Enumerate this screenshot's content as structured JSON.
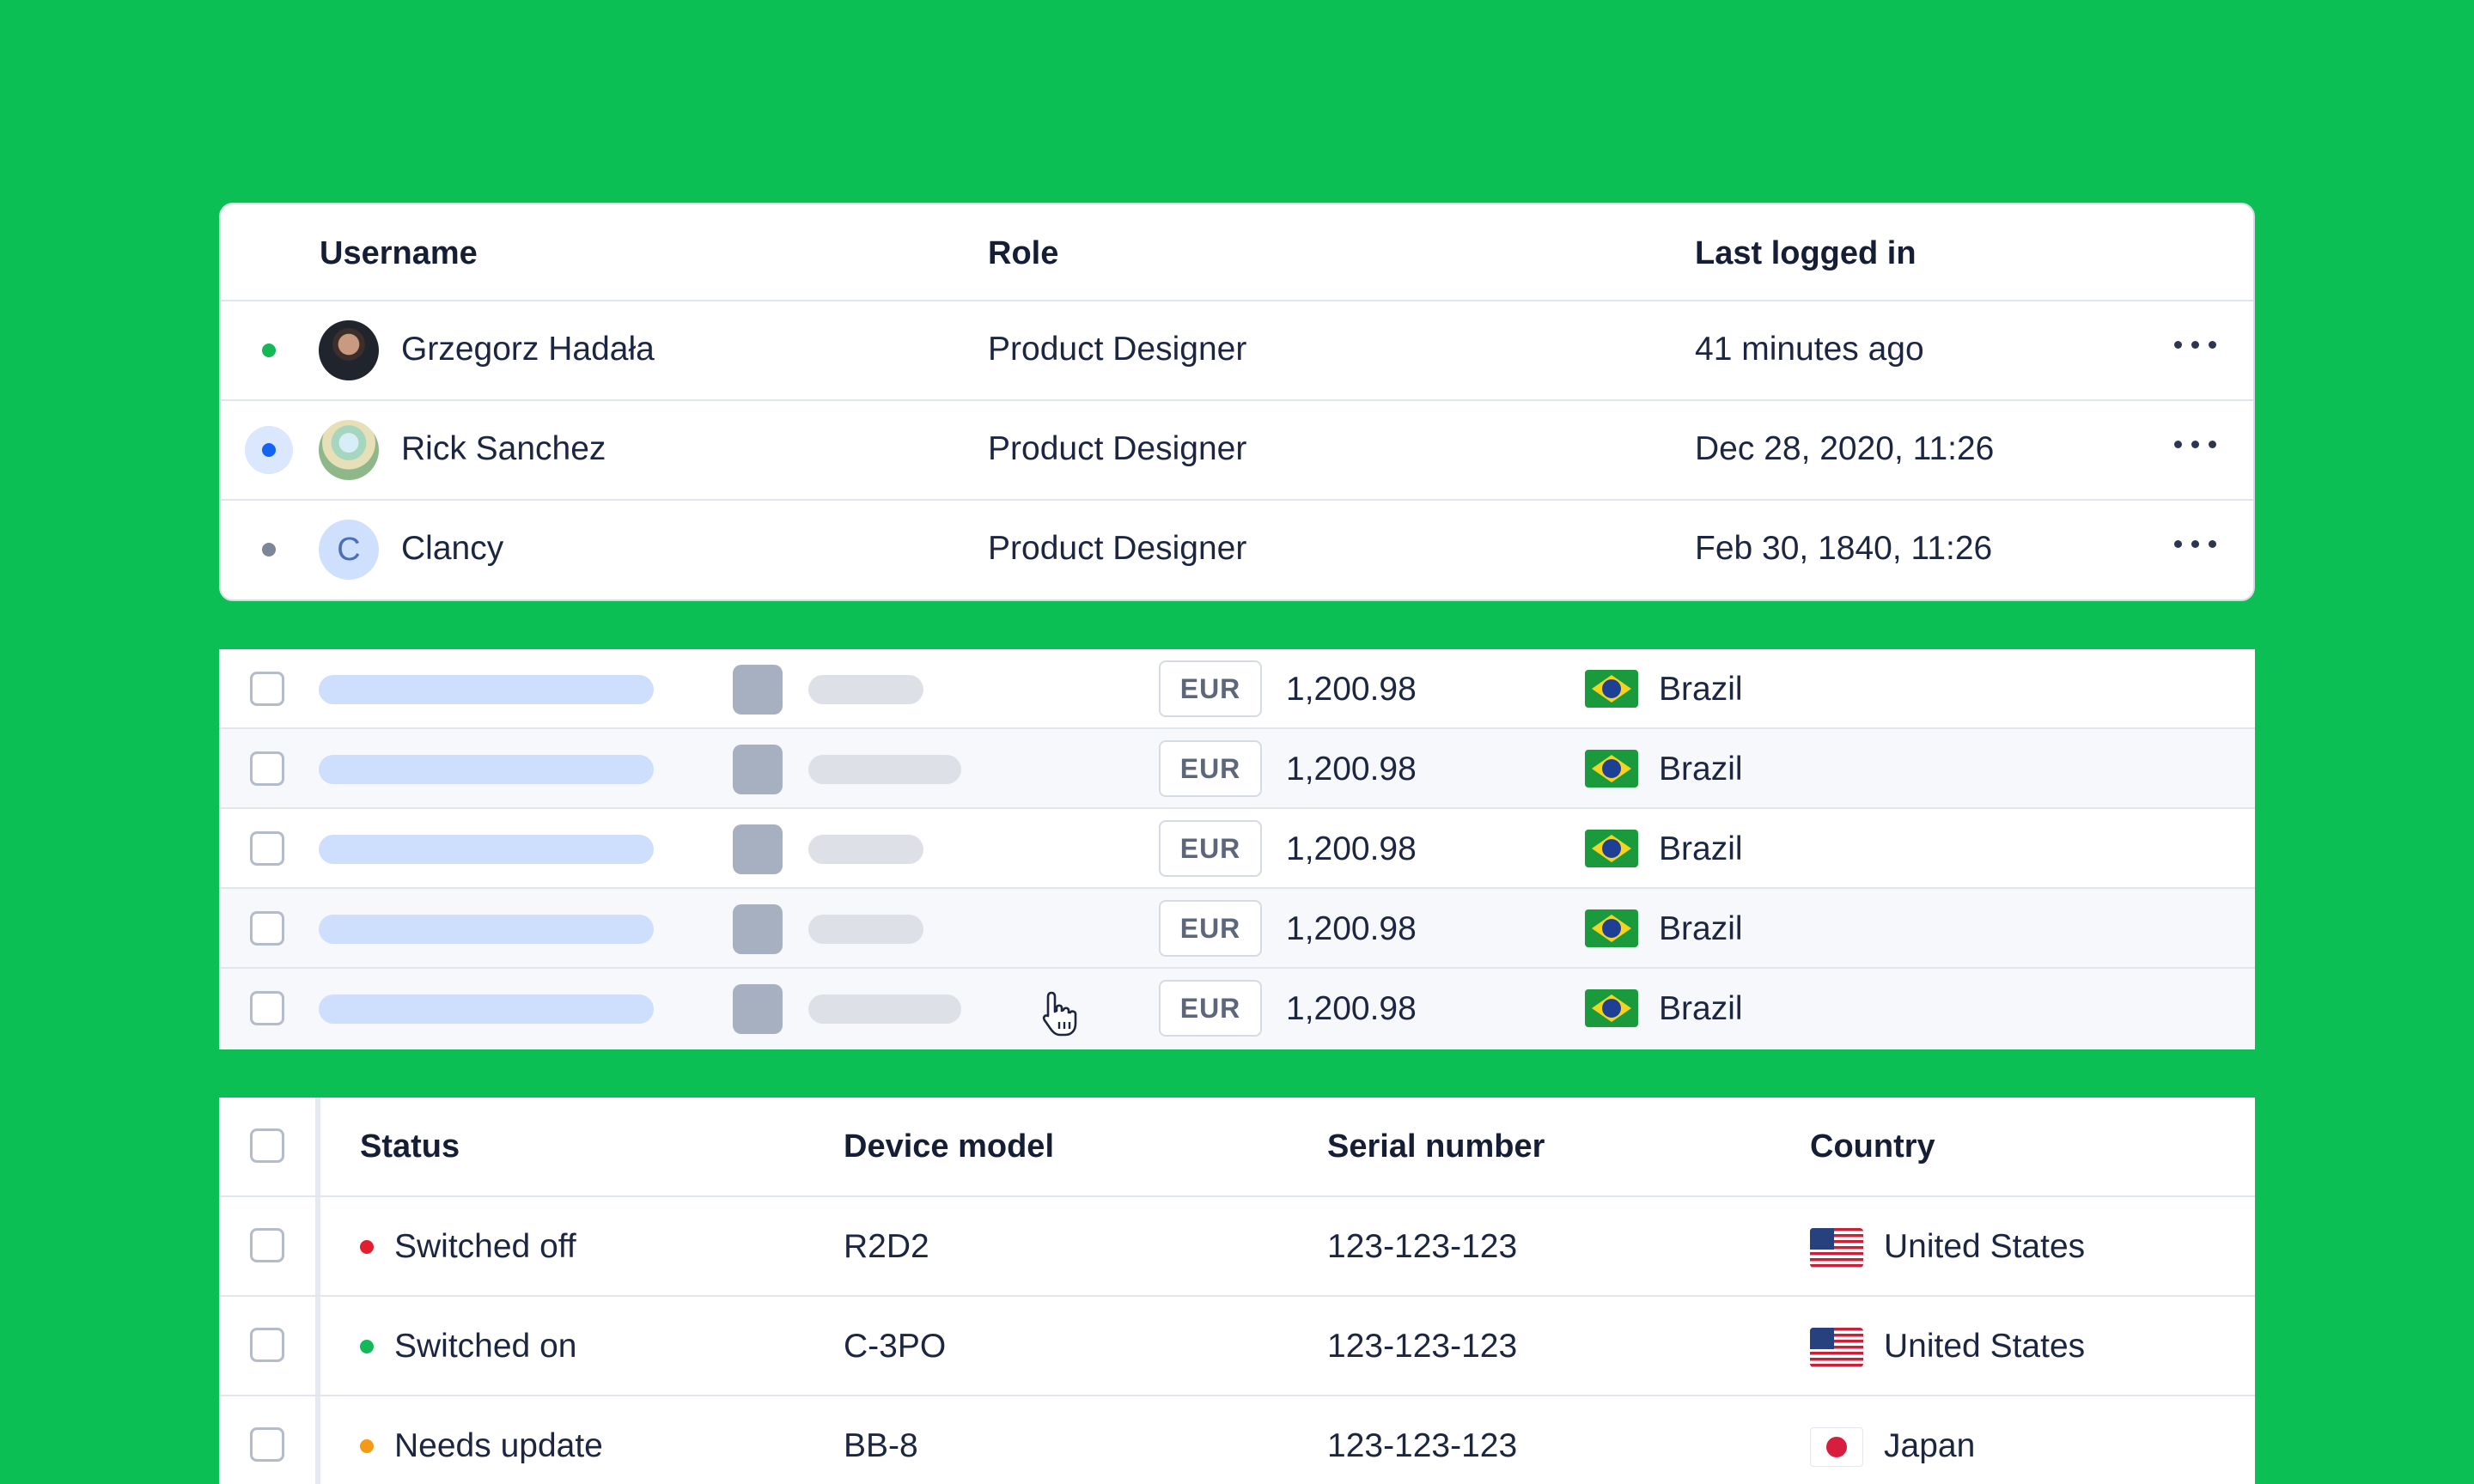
{
  "colors": {
    "background": "#0bbf55",
    "online": "#13b857",
    "selected": "#1463f5",
    "offline": "#7c8699",
    "status_off": "#e11d2f",
    "status_on": "#13b857",
    "status_update": "#f59a14"
  },
  "users_table": {
    "headers": {
      "username": "Username",
      "role": "Role",
      "last_logged": "Last logged in"
    },
    "rows": [
      {
        "status": "online",
        "avatar": "photo",
        "avatar_initial": "",
        "name": "Grzegorz Hadała",
        "role": "Product Designer",
        "last": "41 minutes ago",
        "menu_icon": "more-icon"
      },
      {
        "status": "selected",
        "avatar": "photo",
        "avatar_initial": "",
        "name": "Rick Sanchez",
        "role": "Product Designer",
        "last": "Dec 28, 2020, 11:26",
        "menu_icon": "more-icon"
      },
      {
        "status": "offline",
        "avatar": "initial",
        "avatar_initial": "C",
        "name": "Clancy",
        "role": "Product Designer",
        "last": "Feb 30, 1840, 11:26",
        "menu_icon": "more-icon"
      }
    ]
  },
  "transactions_table": {
    "rows": [
      {
        "currency": "EUR",
        "amount": "1,200.98",
        "country": "Brazil",
        "flag": "brazil-flag-icon"
      },
      {
        "currency": "EUR",
        "amount": "1,200.98",
        "country": "Brazil",
        "flag": "brazil-flag-icon"
      },
      {
        "currency": "EUR",
        "amount": "1,200.98",
        "country": "Brazil",
        "flag": "brazil-flag-icon"
      },
      {
        "currency": "EUR",
        "amount": "1,200.98",
        "country": "Brazil",
        "flag": "brazil-flag-icon"
      },
      {
        "currency": "EUR",
        "amount": "1,200.98",
        "country": "Brazil",
        "flag": "brazil-flag-icon"
      }
    ]
  },
  "devices_table": {
    "headers": {
      "status": "Status",
      "model": "Device model",
      "serial": "Serial number",
      "country": "Country"
    },
    "rows": [
      {
        "status": "Switched off",
        "model": "R2D2",
        "serial": "123-123-123",
        "country": "United States",
        "flag": "us-flag-icon"
      },
      {
        "status": "Switched on",
        "model": "C-3PO",
        "serial": "123-123-123",
        "country": "United States",
        "flag": "us-flag-icon"
      },
      {
        "status": "Needs update",
        "model": "BB-8",
        "serial": "123-123-123",
        "country": "Japan",
        "flag": "japan-flag-icon"
      }
    ]
  }
}
